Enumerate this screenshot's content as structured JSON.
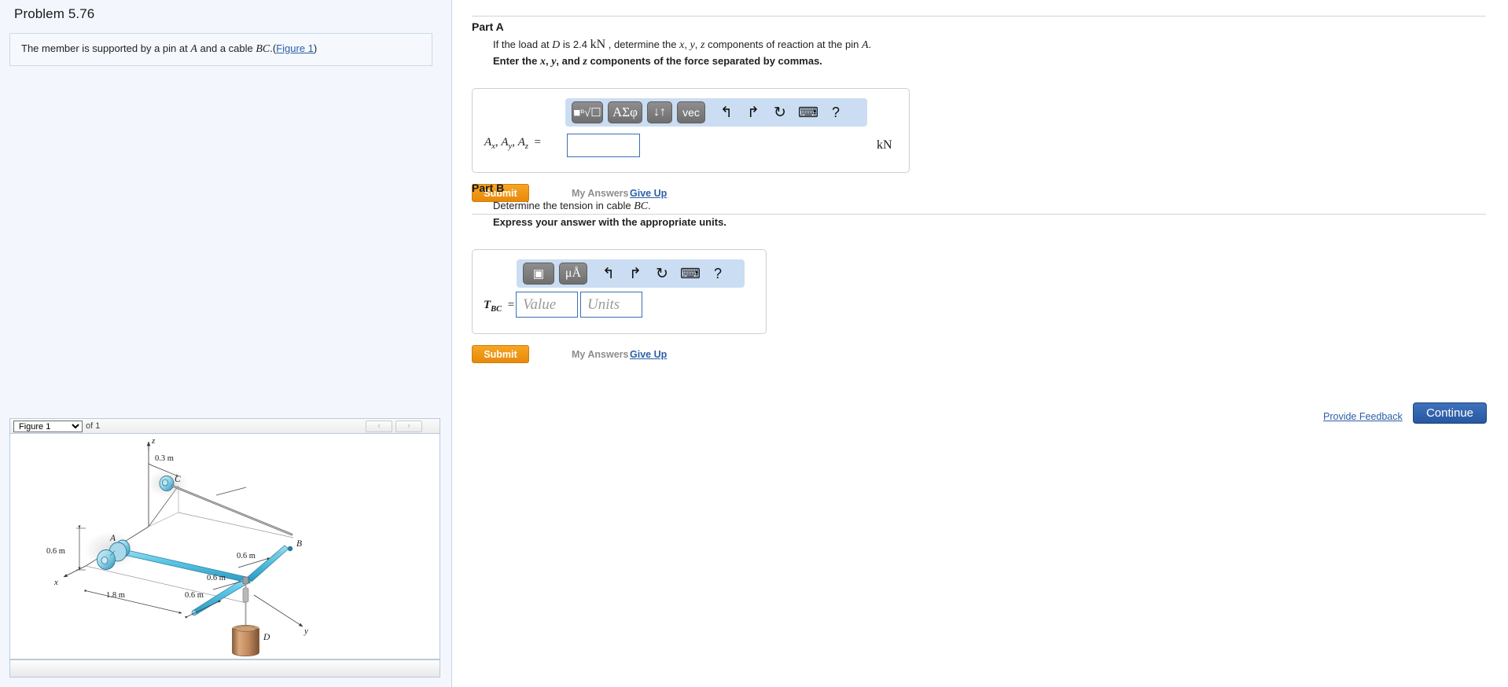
{
  "problem": {
    "title": "Problem 5.76",
    "statement_pre": "The member is supported by a pin at ",
    "statement_A": "A",
    "statement_mid": " and a cable ",
    "statement_BC": "BC",
    "statement_dot": ".(",
    "figure_link": "Figure 1",
    "statement_end": ")"
  },
  "figure": {
    "selected": "Figure 1",
    "options": [
      "Figure 1"
    ],
    "of_label": "of 1",
    "prev_icon": "‹",
    "next_icon": "›",
    "labels": {
      "z_axis": "z",
      "x_axis": "x",
      "y_axis": "y",
      "point_A": "A",
      "point_B": "B",
      "point_C": "C",
      "point_D": "D",
      "dim_0_3": "0.3 m",
      "dim_0_6_left": "0.6 m",
      "dim_1_8": "1.8 m",
      "dim_0_6_bottom": "0.6 m",
      "dim_0_6_mid": "0.6 m",
      "dim_0_6_right": "0.6 m"
    },
    "colors": {
      "member": "#5ec8e8",
      "member_dark": "#2a96bd",
      "weight": "#c08a5e",
      "weight_dark": "#8a5e3c",
      "line": "#4a4a4a"
    }
  },
  "partA": {
    "heading": "Part A",
    "prompt_1a": "If the load at ",
    "prompt_1b": "D",
    "prompt_1c": " is 2.4 ",
    "prompt_unit": "kN",
    "prompt_1d": " , determine the ",
    "prompt_x": "x",
    "prompt_comma1": ", ",
    "prompt_y": "y",
    "prompt_comma2": ", ",
    "prompt_z": "z",
    "prompt_1e": " components of reaction at the pin ",
    "prompt_1f": "A",
    "prompt_1g": ".",
    "instruction_a": "Enter the ",
    "instruction_x": "x",
    "instruction_b": ", ",
    "instruction_y": "y",
    "instruction_c": ", and ",
    "instruction_z": "z",
    "instruction_d": " components of the force separated by commas.",
    "toolbar": [
      {
        "name": "template-radical-button",
        "label": "■ⁿ√☐"
      },
      {
        "name": "greek-symbols-button",
        "label": "ΑΣφ"
      },
      {
        "name": "sort-arrows-button",
        "label": "↓↑"
      },
      {
        "name": "vector-button",
        "label": "vec"
      },
      {
        "name": "undo-icon",
        "label": "↰"
      },
      {
        "name": "redo-icon",
        "label": "↱"
      },
      {
        "name": "reset-icon",
        "label": "↻"
      },
      {
        "name": "keyboard-icon",
        "label": "⌨"
      },
      {
        "name": "help-icon",
        "label": "?"
      }
    ],
    "equation_label": "A",
    "eq_sub_x": "x",
    "eq_sub_y": "y",
    "eq_sub_z": "z",
    "eq_equals": "=",
    "input_value": "",
    "input_placeholder": "",
    "unit": "kN",
    "submit_label": "Submit",
    "my_answers_label": "My Answers",
    "give_up_label": "Give Up"
  },
  "partB": {
    "heading": "Part B",
    "prompt_a": "Determine the tension in cable ",
    "prompt_bc": "BC",
    "prompt_b": ".",
    "instruction": "Express your answer with the appropriate units.",
    "toolbar": [
      {
        "name": "template-layout-button",
        "label": "▣"
      },
      {
        "name": "units-symbols-button",
        "label": "μÅ"
      },
      {
        "name": "undo-icon",
        "label": "↰"
      },
      {
        "name": "redo-icon",
        "label": "↱"
      },
      {
        "name": "reset-icon",
        "label": "↻"
      },
      {
        "name": "keyboard-icon",
        "label": "⌨"
      },
      {
        "name": "help-icon",
        "label": "?"
      }
    ],
    "equation_label": "T",
    "eq_sub": "BC",
    "eq_equals": "=",
    "value_placeholder": "Value",
    "value_input": "",
    "units_placeholder": "Units",
    "units_input": "",
    "submit_label": "Submit",
    "my_answers_label": "My Answers",
    "give_up_label": "Give Up"
  },
  "footer": {
    "provide_feedback": "Provide Feedback",
    "continue_label": "Continue"
  },
  "colors": {
    "accent_orange": "#e8890b",
    "accent_blue": "#2857a0",
    "link_blue": "#2b5fa8",
    "panel_bg": "#f3f7fd",
    "mathbar_bg": "#cbddf2"
  }
}
